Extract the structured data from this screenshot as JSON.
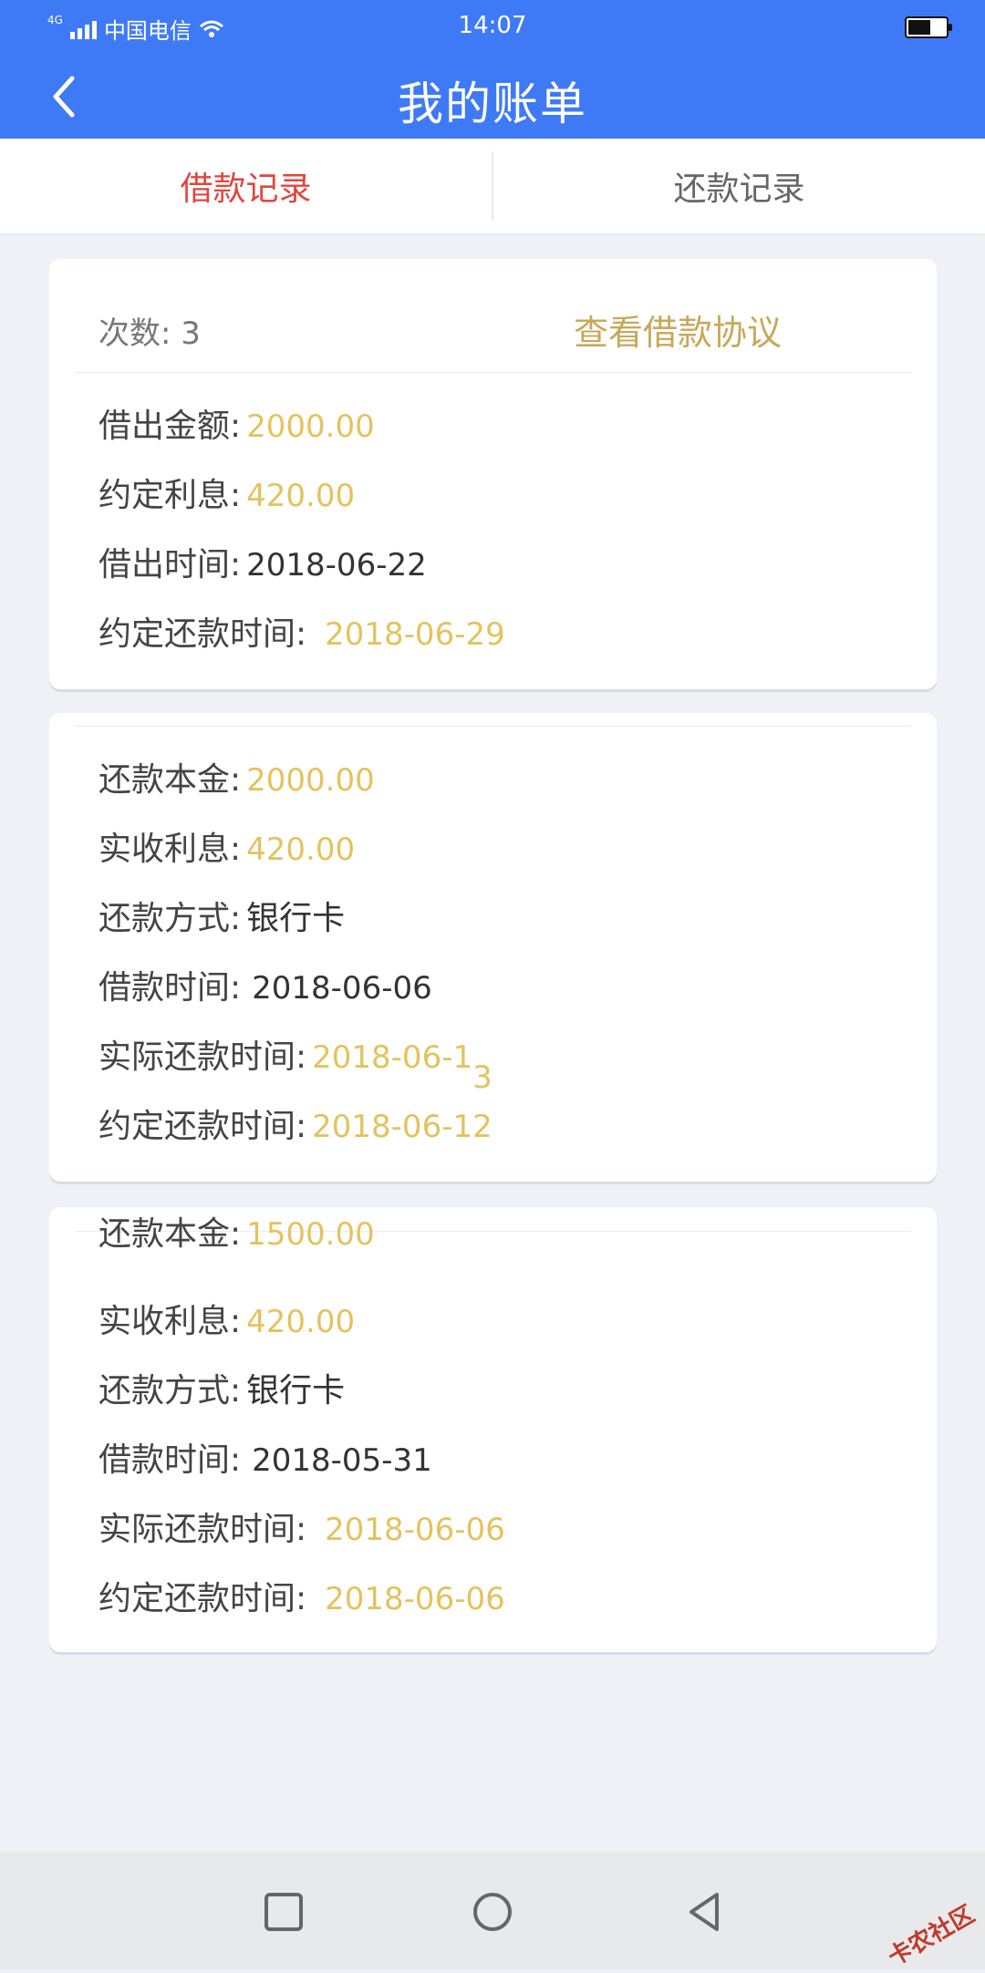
{
  "status_bar": {
    "network": "4G",
    "carrier": "中国电信",
    "time": "14:07"
  },
  "header": {
    "title": "我的账单"
  },
  "tabs": [
    {
      "label": "借款记录",
      "active": true
    },
    {
      "label": "还款记录",
      "active": false
    }
  ],
  "loan_card": {
    "count_text": "次数: 3",
    "agreement_link": "查看借款协议",
    "rows": [
      {
        "label": "借出金额:",
        "value": "2000.00",
        "highlight": true
      },
      {
        "label": "约定利息:",
        "value": "420.00",
        "highlight": true
      },
      {
        "label": "借出时间:",
        "value": "2018-06-22",
        "highlight": false
      },
      {
        "label": "约定还款时间:",
        "value": "2018-06-29",
        "highlight": true
      }
    ]
  },
  "repay_card_1": {
    "rows": [
      {
        "label": "还款本金:",
        "value": "2000.00",
        "highlight": true
      },
      {
        "label": "实收利息:",
        "value": "420.00",
        "highlight": true
      },
      {
        "label": "还款方式:",
        "value": "银行卡",
        "highlight": false
      },
      {
        "label": "借款时间:",
        "value": "2018-06-06",
        "highlight": false
      },
      {
        "label": "实际还款时间:",
        "value": "2018-06-1",
        "value_extra": "3",
        "highlight": true
      },
      {
        "label": "约定还款时间:",
        "value": "2018-06-12",
        "highlight": true
      }
    ]
  },
  "repay_card_2": {
    "rows": [
      {
        "label": "还款本金:",
        "value": "1500.00",
        "highlight": true
      },
      {
        "label": "实收利息:",
        "value": "420.00",
        "highlight": true
      },
      {
        "label": "还款方式:",
        "value": "银行卡",
        "highlight": false
      },
      {
        "label": "借款时间:",
        "value": "2018-05-31",
        "highlight": false
      },
      {
        "label": "实际还款时间:",
        "value": "2018-06-06",
        "highlight": true
      },
      {
        "label": "约定还款时间:",
        "value": "2018-06-06",
        "highlight": true
      }
    ]
  },
  "watermark": "卡农社区",
  "colors": {
    "header_bg": "#3f7af6",
    "active_tab": "#e0463e",
    "link": "#c8a85a",
    "highlight_value": "#e3c35f",
    "page_bg": "#eef1f5"
  }
}
